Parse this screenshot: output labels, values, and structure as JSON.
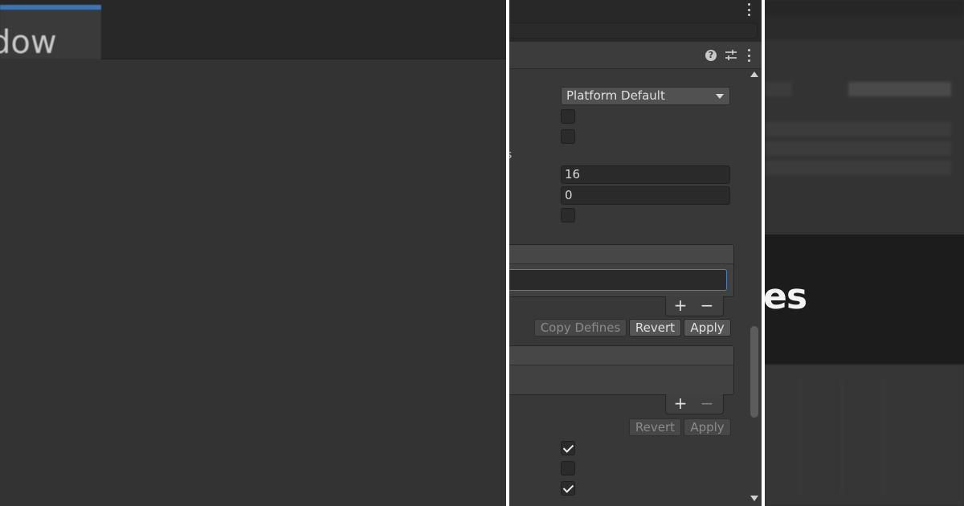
{
  "left_panel": {
    "tab_label": "dow"
  },
  "inspector": {
    "graphics_api_dropdown": {
      "value": "Platform Default"
    },
    "clipped_label": "s",
    "fields": [
      {
        "value": "16"
      },
      {
        "value": "0"
      }
    ],
    "list_buttons": {
      "add": "+",
      "remove": "−"
    },
    "buttons": {
      "copy_defines": "Copy Defines",
      "revert": "Revert",
      "apply": "Apply"
    },
    "second_list_buttons": {
      "add": "+",
      "remove": "−"
    },
    "second_buttons": {
      "revert": "Revert",
      "apply": "Apply"
    },
    "help_icon": "?",
    "checkboxes": [
      {
        "checked": false
      },
      {
        "checked": false
      },
      {
        "checked": false
      },
      {
        "checked": true
      },
      {
        "checked": false
      },
      {
        "checked": true
      }
    ]
  },
  "right_panel": {
    "band_text": "es"
  },
  "colors": {
    "accent_tab": "#3a76b6",
    "focus_border": "#4b7fb6",
    "panel_bg": "#383838"
  },
  "icons": [
    "kebab-menu-icon",
    "help-icon",
    "preset-sliders-icon",
    "dropdown-arrow-icon",
    "checkmark-icon",
    "scroll-up-icon",
    "scroll-down-icon"
  ]
}
